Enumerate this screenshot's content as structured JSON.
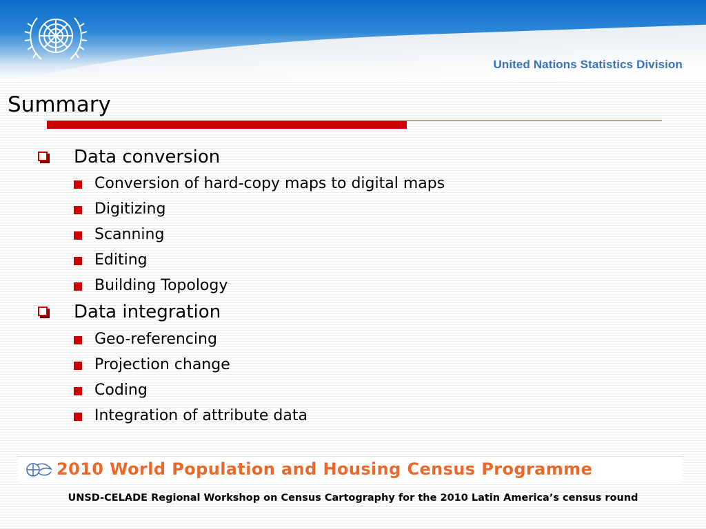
{
  "header": {
    "organization": "United Nations Statistics Division",
    "emblem_icon": "un-emblem-icon"
  },
  "slide": {
    "title": "Summary",
    "accent_color": "#cc0000",
    "sections": [
      {
        "label": "Data conversion",
        "items": [
          "Conversion of hard-copy maps to digital maps",
          "Digitizing",
          "Scanning",
          "Editing",
          "Building Topology"
        ]
      },
      {
        "label": "Data integration",
        "items": [
          "Geo-referencing",
          "Projection change",
          "Coding",
          "Integration of attribute data"
        ]
      }
    ]
  },
  "footer": {
    "banner": "2010 World Population and Housing Census Programme",
    "banner_color": "#e8692a",
    "caption": "UNSD-CELADE Regional Workshop on Census Cartography for the 2010 Latin America’s census round",
    "logo_icon": "census-programme-logo-icon"
  }
}
